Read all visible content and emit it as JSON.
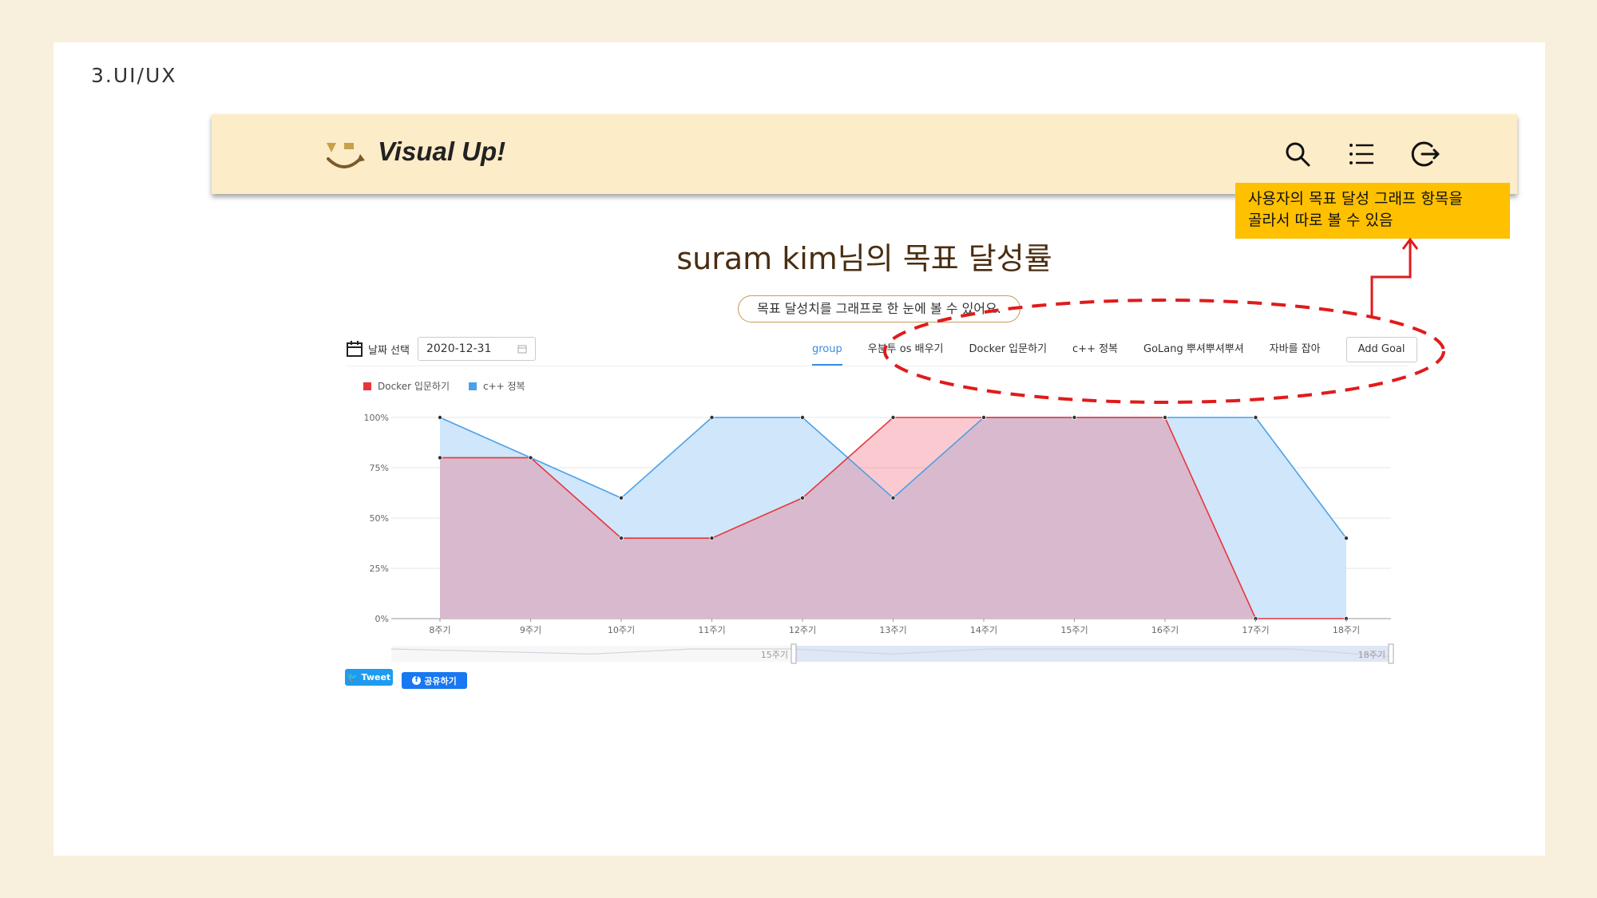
{
  "slide": {
    "section_label": "3.UI/UX"
  },
  "header": {
    "logo_text": "Visual Up!",
    "icons": [
      "search-icon",
      "list-icon",
      "logout-icon"
    ]
  },
  "page": {
    "title": "suram kim님의 목표 달성률",
    "subtitle": "목표 달성치를 그래프로 한 눈에 볼 수 있어요."
  },
  "date_picker": {
    "label": "날짜 선택",
    "value": "2020-12-31"
  },
  "tabs": [
    {
      "label": "group",
      "active": true
    },
    {
      "label": "우분투 os 배우기"
    },
    {
      "label": "Docker 입문하기"
    },
    {
      "label": "c++ 정복"
    },
    {
      "label": "GoLang 뿌셔뿌셔뿌셔"
    },
    {
      "label": "자바를 잡아"
    }
  ],
  "add_goal_label": "Add Goal",
  "share": {
    "tweet": "Tweet",
    "facebook": "공유하기"
  },
  "callout": {
    "line1": "사용자의 목표 달성 그래프 항목을",
    "line2": "골라서 따로 볼 수 있음"
  },
  "colors": {
    "docker": "#e8353d",
    "cpp": "#4aa0e8",
    "overlap": "#cdbfd8",
    "accent": "#3a8de0",
    "callout": "#ffc000"
  },
  "chart_data": {
    "type": "area",
    "x": [
      "8주기",
      "9주기",
      "10주기",
      "11주기",
      "12주기",
      "13주기",
      "14주기",
      "15주기",
      "16주기",
      "17주기",
      "18주기"
    ],
    "series": [
      {
        "name": "Docker 입문하기",
        "values": [
          80,
          80,
          40,
          40,
          60,
          100,
          100,
          100,
          100,
          0,
          0
        ]
      },
      {
        "name": "c++ 정복",
        "values": [
          100,
          80,
          60,
          100,
          100,
          60,
          100,
          100,
          100,
          100,
          40
        ]
      }
    ],
    "y_ticks": [
      "0%",
      "25%",
      "50%",
      "75%",
      "100%"
    ],
    "ylim": [
      0,
      100
    ],
    "grid": true,
    "legend": "top-left",
    "slider_labels": [
      "15주기",
      "18주기"
    ]
  }
}
